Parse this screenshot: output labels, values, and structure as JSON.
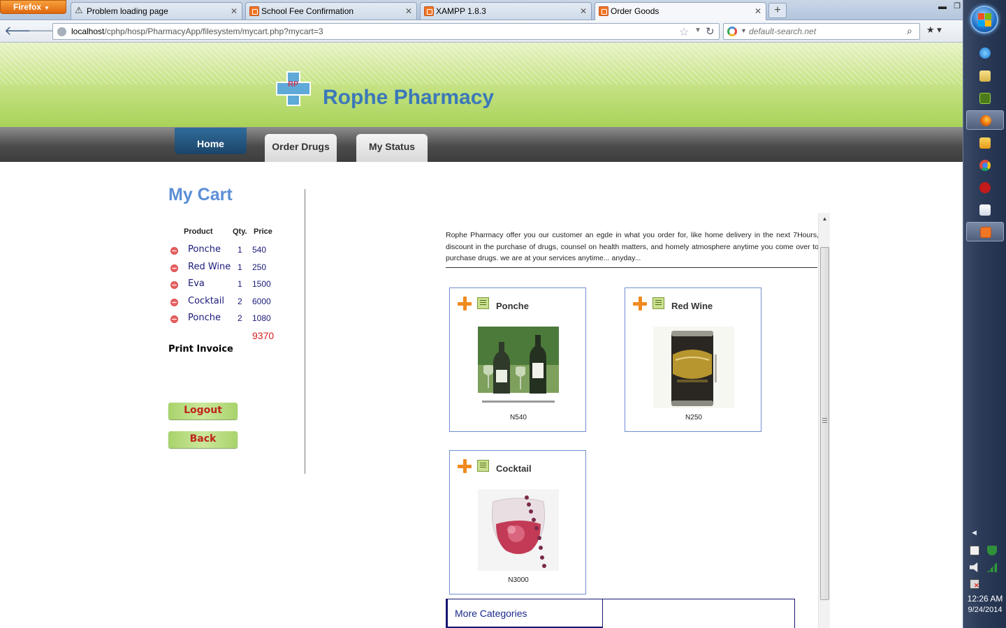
{
  "browser": {
    "menu_button": "Firefox",
    "tabs": [
      {
        "title": "Problem loading page",
        "icon": "warning-icon"
      },
      {
        "title": "School Fee Confirmation",
        "icon": "xampp-icon"
      },
      {
        "title": "XAMPP 1.8.3",
        "icon": "xampp-icon"
      },
      {
        "title": "Order Goods",
        "icon": "xampp-icon",
        "active": true
      }
    ],
    "url_host": "localhost",
    "url_path": "/cphp/hosp/PharmacyApp/filesystem/mycart.php?mycart=3",
    "search_placeholder": "default-search.net"
  },
  "site": {
    "logo_letters": "RP",
    "title": "Rophe Pharmacy",
    "nav": {
      "home": "Home",
      "order_drugs": "Order Drugs",
      "my_status": "My Status"
    }
  },
  "cart": {
    "title": "My Cart",
    "headers": {
      "product": "Product",
      "qty": "Qty.",
      "price": "Price"
    },
    "items": [
      {
        "product": "Ponche",
        "qty": "1",
        "price": "540"
      },
      {
        "product": "Red Wine",
        "qty": "1",
        "price": "250"
      },
      {
        "product": "Eva",
        "qty": "1",
        "price": "1500"
      },
      {
        "product": "Cocktail",
        "qty": "2",
        "price": "6000"
      },
      {
        "product": "Ponche",
        "qty": "2",
        "price": "1080"
      }
    ],
    "total": "9370",
    "print_invoice": "Print Invoice",
    "logout": "Logout",
    "back": "Back"
  },
  "content": {
    "intro": "Rophe Pharmacy offer you our customer an egde in what you order for, like home delivery in the next 7Hours, discount in the purchase of drugs, counsel on health matters, and homely atmosphere anytime you come over to purchase drugs. we are at your services anytime... anyday...",
    "products": [
      {
        "name": "Ponche",
        "price": "N540"
      },
      {
        "name": "Red Wine",
        "price": "N250"
      },
      {
        "name": "Cocktail",
        "price": "N3000"
      }
    ],
    "more_categories": "More Categories"
  },
  "taskbar": {
    "clock_time": "12:26 AM",
    "clock_date": "9/24/2014"
  },
  "colors": {
    "header_green": "#a9d259",
    "title_blue": "#3b78b8",
    "cart_title": "#5b8fd6",
    "card_border": "#6f8fd1",
    "total_red": "#d42020",
    "button_text": "#c0241d"
  }
}
